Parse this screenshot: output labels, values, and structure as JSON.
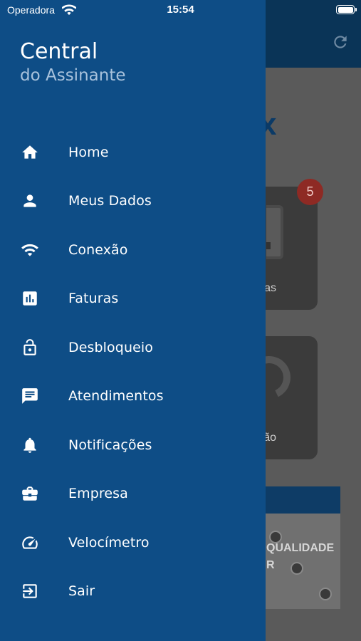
{
  "status_bar": {
    "carrier": "Operadora",
    "time": "15:54"
  },
  "drawer": {
    "title": "Central",
    "subtitle": "do Assinante",
    "items": [
      {
        "label": "Home",
        "icon": "home-icon"
      },
      {
        "label": "Meus Dados",
        "icon": "person-icon"
      },
      {
        "label": "Conexão",
        "icon": "wifi-icon"
      },
      {
        "label": "Faturas",
        "icon": "chart-icon"
      },
      {
        "label": "Desbloqueio",
        "icon": "unlock-icon"
      },
      {
        "label": "Atendimentos",
        "icon": "chat-icon"
      },
      {
        "label": "Notificações",
        "icon": "bell-icon"
      },
      {
        "label": "Empresa",
        "icon": "briefcase-icon"
      },
      {
        "label": "Velocímetro",
        "icon": "speedometer-icon"
      },
      {
        "label": "Sair",
        "icon": "logout-icon"
      }
    ]
  },
  "background": {
    "card1_label": "as",
    "card2_label": "ão",
    "badge_count": "5",
    "banner_text": "QUALIDADE",
    "banner_text2": "R"
  },
  "colors": {
    "drawer_bg": "#0e4d86",
    "header_bg": "#0a3457",
    "subtitle": "#a8c2dc",
    "badge": "#c0392b"
  }
}
